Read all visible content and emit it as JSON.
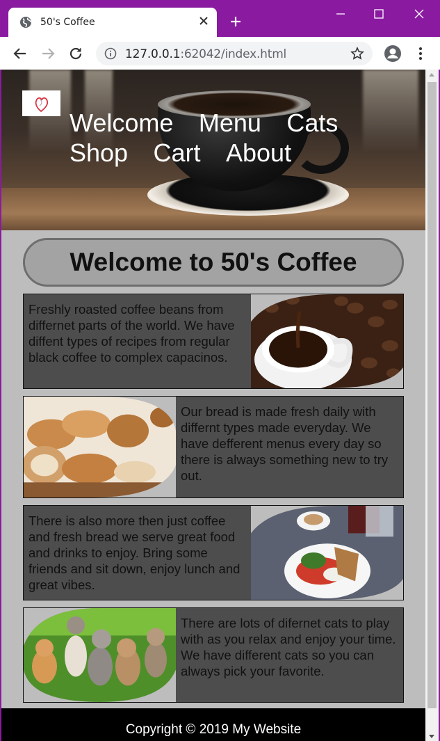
{
  "browser": {
    "tab_title": "50's Coffee",
    "url_host": "127.0.0.1",
    "url_rest": ":62042/index.html"
  },
  "header": {
    "nav": [
      "Welcome",
      "Menu",
      "Cats",
      "Shop",
      "Cart",
      "About"
    ]
  },
  "main": {
    "title": "Welcome to 50's Coffee",
    "cards": [
      {
        "text": "Freshly roasted coffee beans from differnet parts of the world. We have diffent types of recipes from regular black coffee to complex capacinos.",
        "image": "coffee-cup-beans-photo"
      },
      {
        "text": "Our bread is made fresh daily with differnt types made everyday. We have defferent menus every day so there is always something new to try out.",
        "image": "bread-loaves-photo"
      },
      {
        "text": "There is also more then just coffee and fresh bread we serve great food and drinks to enjoy. Bring some friends and sit down, enjoy lunch and great vibes.",
        "image": "lunch-plate-photo"
      },
      {
        "text": "There are lots of difernet cats to play with as you relax and enjoy your time. We have different cats so you can always pick your favorite.",
        "image": "kittens-photo"
      }
    ]
  },
  "footer": {
    "copyright": "Copyright © 2019 My Website"
  },
  "colors": {
    "titlebar": "#8a1aa0",
    "page_bg": "#bdbdbd",
    "card_bg": "#4d4d4d",
    "footer_bg": "#000000"
  }
}
